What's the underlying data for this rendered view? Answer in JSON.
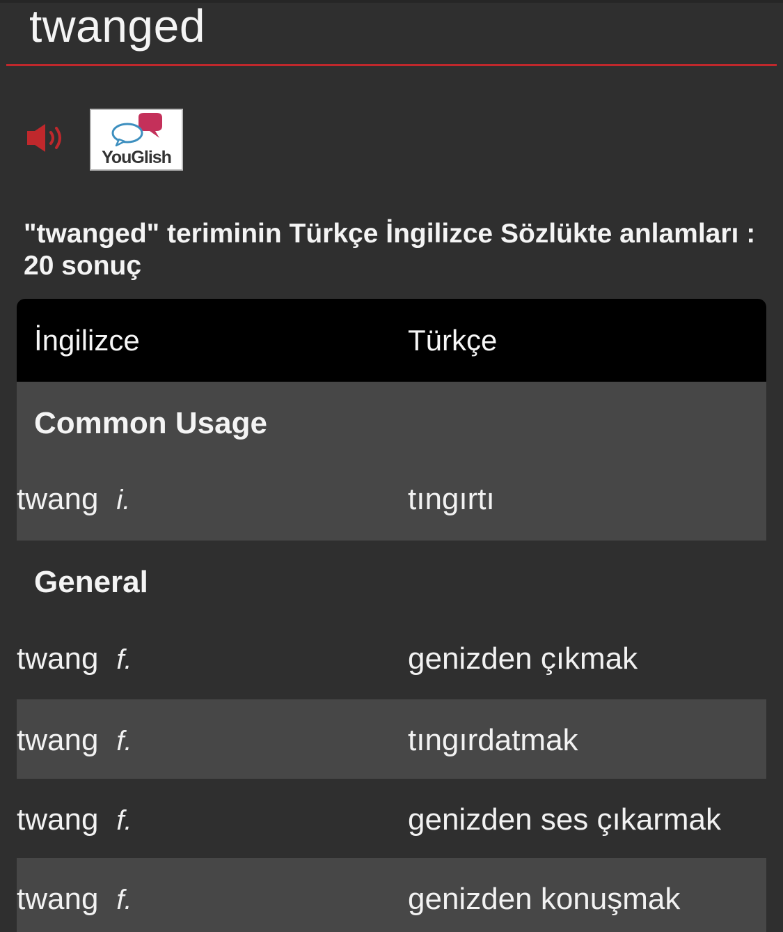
{
  "header": {
    "word": "twanged"
  },
  "actions": {
    "audio_icon": "speaker-icon",
    "youglish_label": "YouGlish"
  },
  "colors": {
    "accent": "#c0282c",
    "background": "#2f2f2f",
    "row_light": "#474747",
    "table_header": "#000000"
  },
  "result": {
    "heading": "\"twanged\" teriminin Türkçe İngilizce Sözlükte anlamları : 20 sonuç"
  },
  "table": {
    "columns": {
      "english": "İngilizce",
      "turkish": "Türkçe"
    },
    "sections": [
      {
        "label": "Common Usage",
        "rows": [
          {
            "term": "twang",
            "pos": "i.",
            "translation": "tıngırtı"
          }
        ]
      },
      {
        "label": "General",
        "rows": [
          {
            "term": "twang",
            "pos": "f.",
            "translation": "genizden çıkmak"
          },
          {
            "term": "twang",
            "pos": "f.",
            "translation": "tıngırdatmak"
          },
          {
            "term": "twang",
            "pos": "f.",
            "translation": "genizden ses çıkarmak"
          },
          {
            "term": "twang",
            "pos": "f.",
            "translation": "genizden konuşmak"
          }
        ]
      }
    ]
  }
}
